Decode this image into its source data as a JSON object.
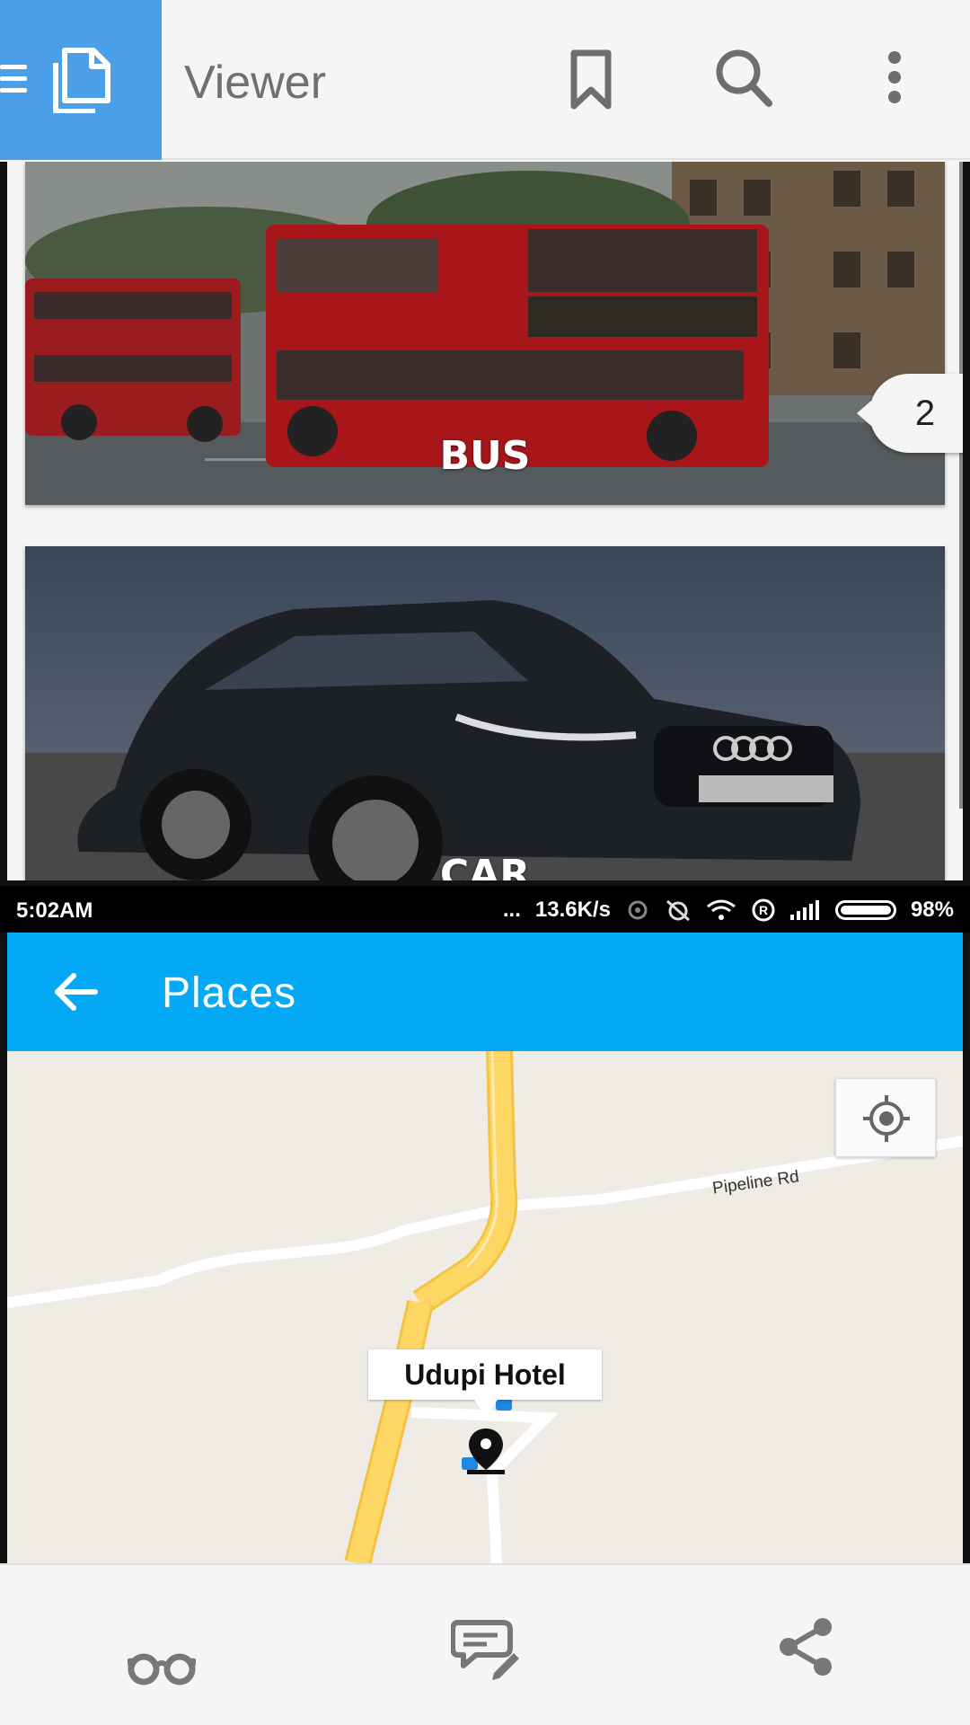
{
  "viewer": {
    "title": "Viewer",
    "icons": [
      "menu-icon",
      "document-icon",
      "bookmark-icon",
      "search-icon",
      "more-vert-icon"
    ]
  },
  "document": {
    "cards": [
      {
        "caption": "BUS"
      },
      {
        "caption": "CAR"
      }
    ],
    "page_badge": "2"
  },
  "status_bar": {
    "time": "5:02AM",
    "dots": "...",
    "speed": "13.6K/s",
    "battery": "98%"
  },
  "places": {
    "title": "Places",
    "map": {
      "road_label": "Pipeline Rd",
      "marker_title": "Udupi Hotel"
    }
  },
  "bottom_toolbar": {
    "icons": [
      "reading-glasses-icon",
      "comment-edit-icon",
      "share-icon"
    ]
  },
  "colors": {
    "viewer_accent": "#4a9fe8",
    "places_bar": "#03a9f4",
    "map_bg": "#efece5",
    "road_main": "#fdd663"
  }
}
